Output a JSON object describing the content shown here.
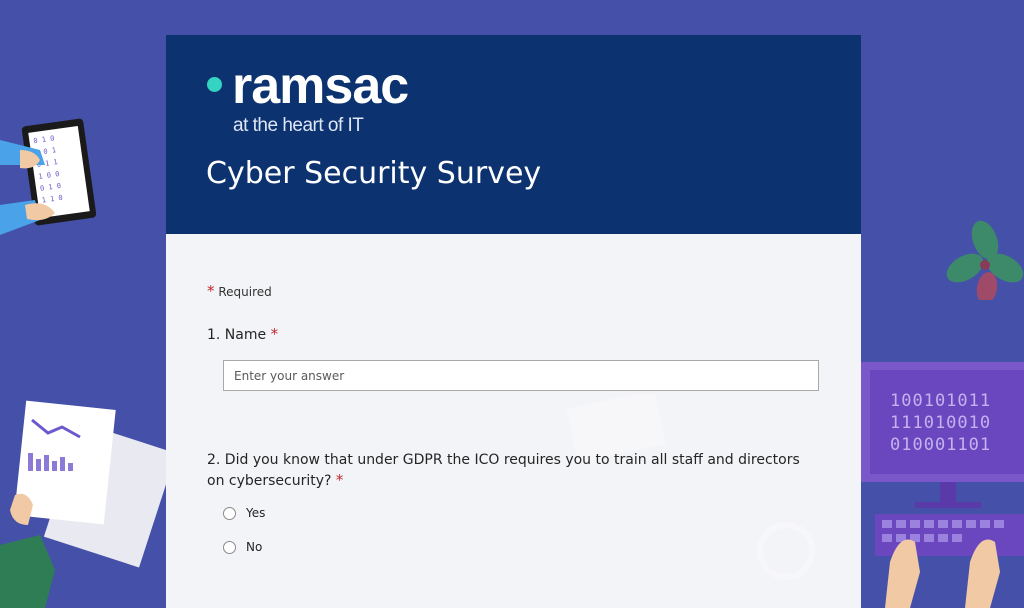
{
  "banner": {
    "brand": "ramsac",
    "tagline": "at the heart of IT",
    "form_title": "Cyber Security Survey"
  },
  "form": {
    "required_marker": "*",
    "required_text": "Required",
    "questions": [
      {
        "label": "1. Name",
        "required": "*",
        "placeholder": "Enter your answer"
      },
      {
        "label": "2. Did you know that under GDPR the ICO requires you to train all staff and directors on cybersecurity?",
        "required": "*",
        "options": [
          "Yes",
          "No"
        ]
      }
    ]
  },
  "decor": {
    "binary_lines": [
      "100101011",
      "111010010",
      "010001101"
    ],
    "icons": [
      "tablet-hands-illustration",
      "chart-papers-illustration",
      "leaf-plant-illustration",
      "computer-keyboard-illustration"
    ],
    "colors": {
      "background": "#4550a8",
      "banner": "#0c3270",
      "accent": "#35d3c1",
      "required": "#c4262e"
    }
  }
}
